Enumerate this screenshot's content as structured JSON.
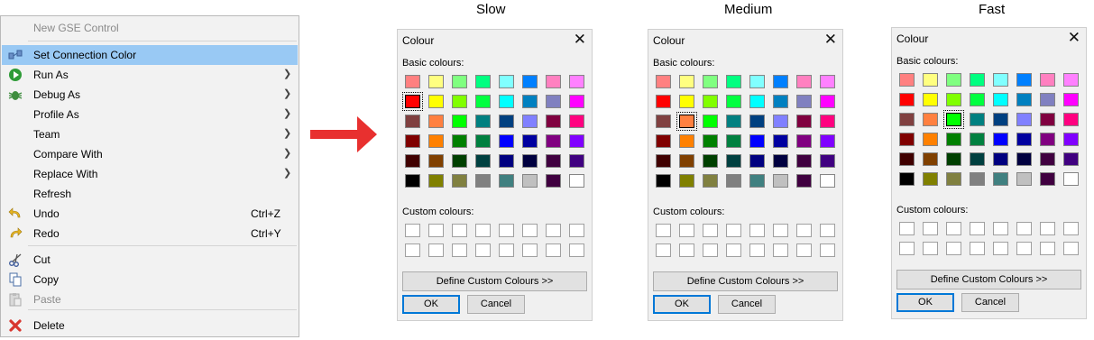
{
  "menu": {
    "items": [
      {
        "label": "New GSE Control",
        "disabled": true,
        "icon": ""
      },
      {
        "label": "Set Connection Color",
        "highlighted": true,
        "icon": "connection-color-icon"
      },
      {
        "label": "Run As",
        "submenu": true,
        "icon": "run-icon"
      },
      {
        "label": "Debug As",
        "submenu": true,
        "icon": "debug-bug-icon"
      },
      {
        "label": "Profile As",
        "submenu": true,
        "icon": ""
      },
      {
        "label": "Team",
        "submenu": true,
        "icon": ""
      },
      {
        "label": "Compare With",
        "submenu": true,
        "icon": ""
      },
      {
        "label": "Replace With",
        "submenu": true,
        "icon": ""
      },
      {
        "label": "Refresh",
        "icon": ""
      },
      {
        "label": "Undo",
        "shortcut": "Ctrl+Z",
        "icon": "undo-icon"
      },
      {
        "label": "Redo",
        "shortcut": "Ctrl+Y",
        "icon": "redo-icon"
      },
      {
        "label": "Cut",
        "icon": "scissors-icon"
      },
      {
        "label": "Copy",
        "icon": "copy-icon"
      },
      {
        "label": "Paste",
        "disabled": true,
        "icon": "paste-icon"
      },
      {
        "label": "Delete",
        "icon": "delete-x-icon"
      }
    ]
  },
  "arrow_color": "#e8302f",
  "dialogs": [
    {
      "speed": "Slow",
      "title": "Colour",
      "selected": "1-0"
    },
    {
      "speed": "Medium",
      "title": "Colour",
      "selected": "2-1"
    },
    {
      "speed": "Fast",
      "title": "Colour",
      "selected": "2-2"
    }
  ],
  "dialog_labels": {
    "basic": "Basic colours:",
    "custom": "Custom colours:",
    "define": "Define Custom Colours >>",
    "ok": "OK",
    "cancel": "Cancel",
    "close": "✕"
  },
  "basic_colours": [
    [
      "#ff8080",
      "#ffff80",
      "#80ff80",
      "#00ff80",
      "#80ffff",
      "#0080ff",
      "#ff80c0",
      "#ff80ff"
    ],
    [
      "#ff0000",
      "#ffff00",
      "#80ff00",
      "#00ff40",
      "#00ffff",
      "#0080c0",
      "#8080c0",
      "#ff00ff"
    ],
    [
      "#804040",
      "#ff8040",
      "#00ff00",
      "#008080",
      "#004080",
      "#8080ff",
      "#800040",
      "#ff0080"
    ],
    [
      "#800000",
      "#ff8000",
      "#008000",
      "#008040",
      "#0000ff",
      "#0000a0",
      "#800080",
      "#8000ff"
    ],
    [
      "#400000",
      "#804000",
      "#004000",
      "#004040",
      "#000080",
      "#000040",
      "#400040",
      "#400080"
    ],
    [
      "#000000",
      "#808000",
      "#808040",
      "#808080",
      "#408080",
      "#c0c0c0",
      "#400040",
      "#ffffff"
    ]
  ]
}
